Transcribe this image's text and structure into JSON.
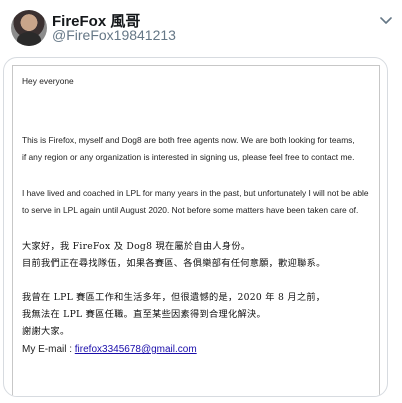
{
  "tweet": {
    "display_name": "FireFox 風哥",
    "handle": "@FireFox19841213"
  },
  "letter": {
    "greeting": "Hey everyone",
    "en_p1_l1": "This is Firefox, myself and Dog8 are both free agents now. We are both looking for teams,",
    "en_p1_l2": "if any region or any organization is interested in signing us, please feel free to contact me.",
    "en_p2_l1": "I have lived and coached in LPL for many years in the past, but unfortunately I will not be able",
    "en_p2_l2": "to serve in LPL again until August 2020. Not before some matters have been taken care of.",
    "zh_p1_l1": "大家好，我 FireFox 及 Dog8 現在屬於自由人身份。",
    "zh_p1_l2": "目前我們正在尋找隊伍，如果各賽區、各俱樂部有任何意願，歡迎聯系。",
    "zh_p2_l1": "我曾在 LPL 賽區工作和生活多年，但很遺憾的是，2020 年 8 月之前，",
    "zh_p2_l2": "我無法在 LPL 賽區任職。直至某些因素得到合理化解決。",
    "zh_p2_l3": "謝謝大家。",
    "email_label": "My E-mail :",
    "email_address": "firefox3345678@gmail.com"
  }
}
